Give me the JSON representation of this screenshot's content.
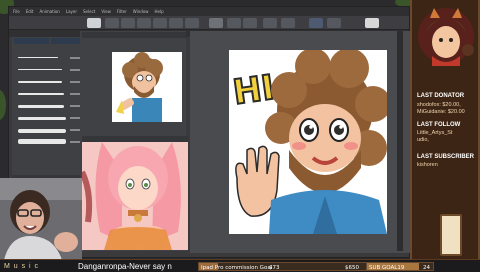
{
  "menubar": {
    "items": [
      "File",
      "Edit",
      "Animation",
      "Layer",
      "Select",
      "View",
      "Filter",
      "Window",
      "Help"
    ]
  },
  "overlay": {
    "donator_heading": "LAST DONATOR",
    "donator_lines": "shodofox: $20.00,\nMiGuidanie: $20.00",
    "follow_heading": "LAST FOLLOW",
    "follow_name": "Little_Artys_St\nudio,",
    "subscriber_heading": "LAST SUBSCRIBER",
    "subscriber_name": "kishoren"
  },
  "bottombar": {
    "music_label": "M u s i c",
    "song": "Danganronpa-Never say n",
    "goal_label": "Ipad Pro commission Goal",
    "goal_current": "$73",
    "goal_target": "$650",
    "goal_progress": 0.11,
    "sub_goal_label": "SUB GOAL19",
    "sub_goal_count": "24",
    "sub_goal_progress": 0.79
  },
  "icons": {
    "cup": "cup-icon",
    "fox_mascot": "fox-mascot-icon",
    "webcam": "webcam-feed"
  }
}
